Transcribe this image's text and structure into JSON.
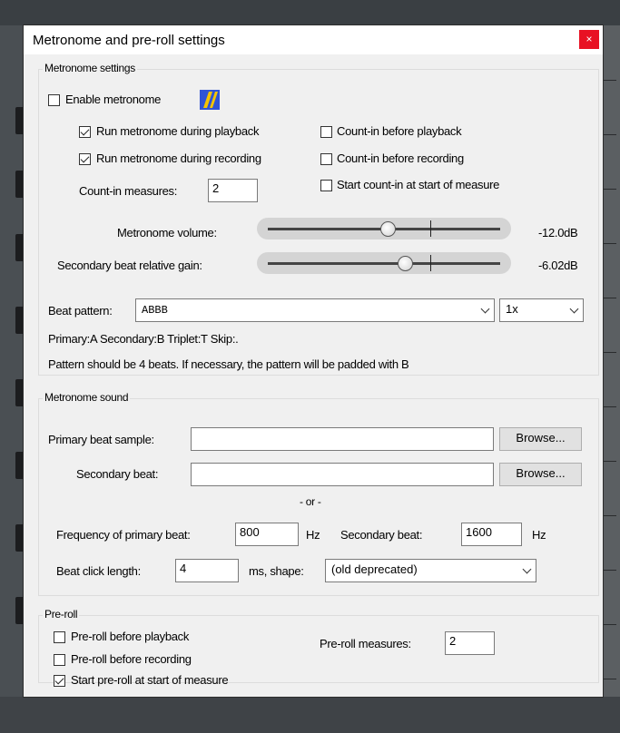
{
  "dialog": {
    "title": "Metronome and pre-roll settings",
    "close_label": "×"
  },
  "metronome": {
    "group_label": "Metronome settings",
    "enable": {
      "label": "Enable metronome",
      "checked": false
    },
    "run_playback": {
      "label": "Run metronome during playback",
      "checked": true
    },
    "run_recording": {
      "label": "Run metronome during recording",
      "checked": true
    },
    "count_in_playback": {
      "label": "Count-in before playback",
      "checked": false
    },
    "count_in_recording": {
      "label": "Count-in before recording",
      "checked": false
    },
    "start_count_in": {
      "label": "Start count-in at start of measure",
      "checked": false
    },
    "count_in_measures_label": "Count-in measures:",
    "count_in_measures_value": "2",
    "volume_label": "Metronome volume:",
    "volume_value": "-12.0dB",
    "volume_level": 0.52,
    "secondary_gain_label": "Secondary beat relative gain:",
    "secondary_gain_value": "-6.02dB",
    "secondary_gain_level": 0.6,
    "beat_pattern_label": "Beat pattern:",
    "beat_pattern_value": "ABBB",
    "beat_multiplier_value": "1x",
    "legend_text": "Primary:A Secondary:B Triplet:T Skip:.",
    "pattern_note": "Pattern should be 4 beats. If necessary, the pattern will be padded with B"
  },
  "sound": {
    "group_label": "Metronome sound",
    "primary_sample_label": "Primary beat sample:",
    "primary_sample_value": "",
    "secondary_beat_label": "Secondary beat:",
    "secondary_beat_value": "",
    "browse_label": "Browse...",
    "or_label": "- or -",
    "freq_primary_label": "Frequency of primary beat:",
    "freq_primary_value": "800",
    "hz_label": "Hz",
    "freq_secondary_label": "Secondary beat:",
    "freq_secondary_value": "1600",
    "click_length_label": "Beat click length:",
    "click_length_value": "4",
    "ms_shape_label": "ms, shape:",
    "shape_value": "(old deprecated)"
  },
  "preroll": {
    "group_label": "Pre-roll",
    "playback": {
      "label": "Pre-roll before playback",
      "checked": false
    },
    "recording": {
      "label": "Pre-roll before recording",
      "checked": false
    },
    "start_measure": {
      "label": "Start pre-roll at start of measure",
      "checked": true
    },
    "measures_label": "Pre-roll measures:",
    "measures_value": "2"
  },
  "colors": {
    "close_button": "#e81123",
    "teal_accent": "#1fa58a",
    "icon_blue": "#2f54d6",
    "icon_yellow": "#f5c400"
  }
}
